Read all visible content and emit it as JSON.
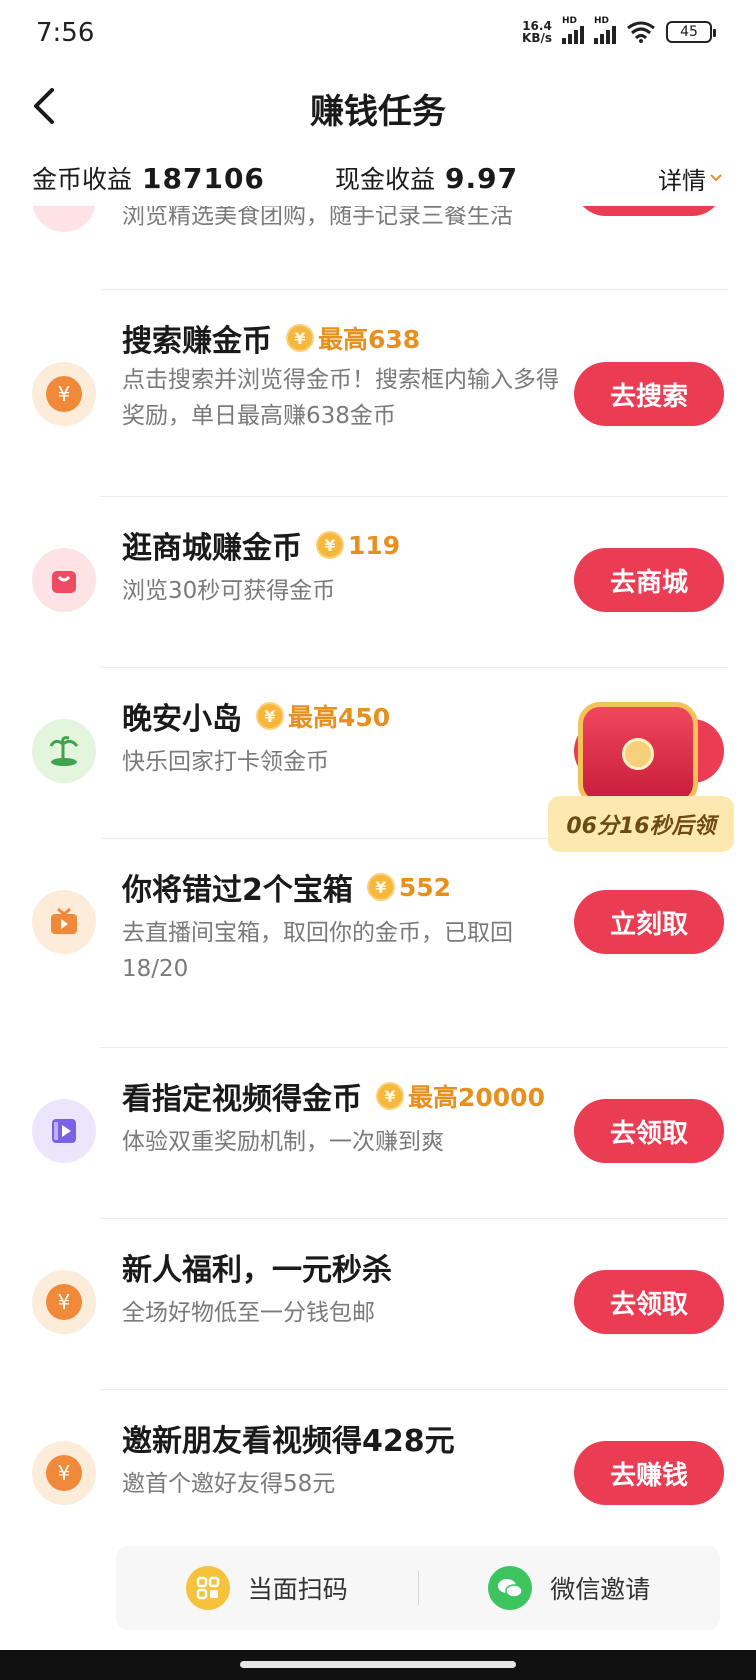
{
  "status_bar": {
    "time": "7:56",
    "net_speed": "16.4",
    "net_unit": "KB/s",
    "hd": "HD",
    "battery": "45"
  },
  "header": {
    "title": "赚钱任务"
  },
  "earnings": {
    "gold_label": "金币收益",
    "gold_value": "187106",
    "cash_label": "现金收益",
    "cash_value": "9.97",
    "details": "详情"
  },
  "partial_task": {
    "desc": "浏览精选美食团购，随手记录三餐生活"
  },
  "tasks": [
    {
      "title": "搜索赚金币",
      "reward": "最高638",
      "desc": "点击搜索并浏览得金币！搜索框内输入多得奖励，单日最高赚638金币",
      "button": "去搜索",
      "icon": "yuan-coin-icon",
      "icon_bg": "#fdecd9"
    },
    {
      "title": "逛商城赚金币",
      "reward": "119",
      "desc": "浏览30秒可获得金币",
      "button": "去商城",
      "icon": "shopping-bag-icon",
      "icon_bg": "#fde3e6"
    },
    {
      "title": "晚安小岛",
      "reward": "最高450",
      "desc": "快乐回家打卡领金币",
      "button": "",
      "icon": "island-icon",
      "icon_bg": "#e4f5dd"
    },
    {
      "title": "你将错过2个宝箱",
      "reward": "552",
      "desc": "去直播间宝箱，取回你的金币，已取回18/20",
      "button": "立刻取",
      "icon": "tv-icon",
      "icon_bg": "#fdecd9"
    },
    {
      "title": "看指定视频得金币",
      "reward": "最高20000",
      "desc": "体验双重奖励机制，一次赚到爽",
      "button": "去领取",
      "icon": "video-icon",
      "icon_bg": "#ebe6fb"
    },
    {
      "title": "新人福利，一元秒杀",
      "reward": "",
      "desc": "全场好物低至一分钱包邮",
      "button": "去领取",
      "icon": "yuan-coin-icon",
      "icon_bg": "#fdecd9"
    },
    {
      "title": "邀新朋友看视频得428元",
      "reward": "",
      "desc": "邀首个邀好友得58元",
      "button": "去赚钱",
      "icon": "yuan-coin-icon",
      "icon_bg": "#fdecd9"
    }
  ],
  "chest": {
    "timer": "06分16秒后领"
  },
  "invite": {
    "scan_label": "当面扫码",
    "wechat_label": "微信邀请"
  },
  "colors": {
    "accent": "#ea3c52",
    "reward": "#e8901e"
  }
}
